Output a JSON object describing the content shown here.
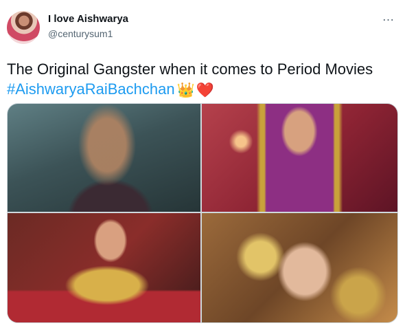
{
  "tweet": {
    "author": {
      "display_name": "I love Aishwarya",
      "handle": "@centurysum1"
    },
    "more_icon": "…",
    "text_line1": "The Original Gangster when it comes to Period Movies",
    "hashtag": "#AishwaryaRaiBachchan",
    "emojis": {
      "crown": "👑",
      "heart": "❤️"
    },
    "media": [
      {
        "id": "photo-1"
      },
      {
        "id": "photo-2"
      },
      {
        "id": "photo-3"
      },
      {
        "id": "photo-4"
      }
    ],
    "colors": {
      "hashtag": "#1d9bf0",
      "text": "#0f1419",
      "secondary": "#536471"
    }
  }
}
